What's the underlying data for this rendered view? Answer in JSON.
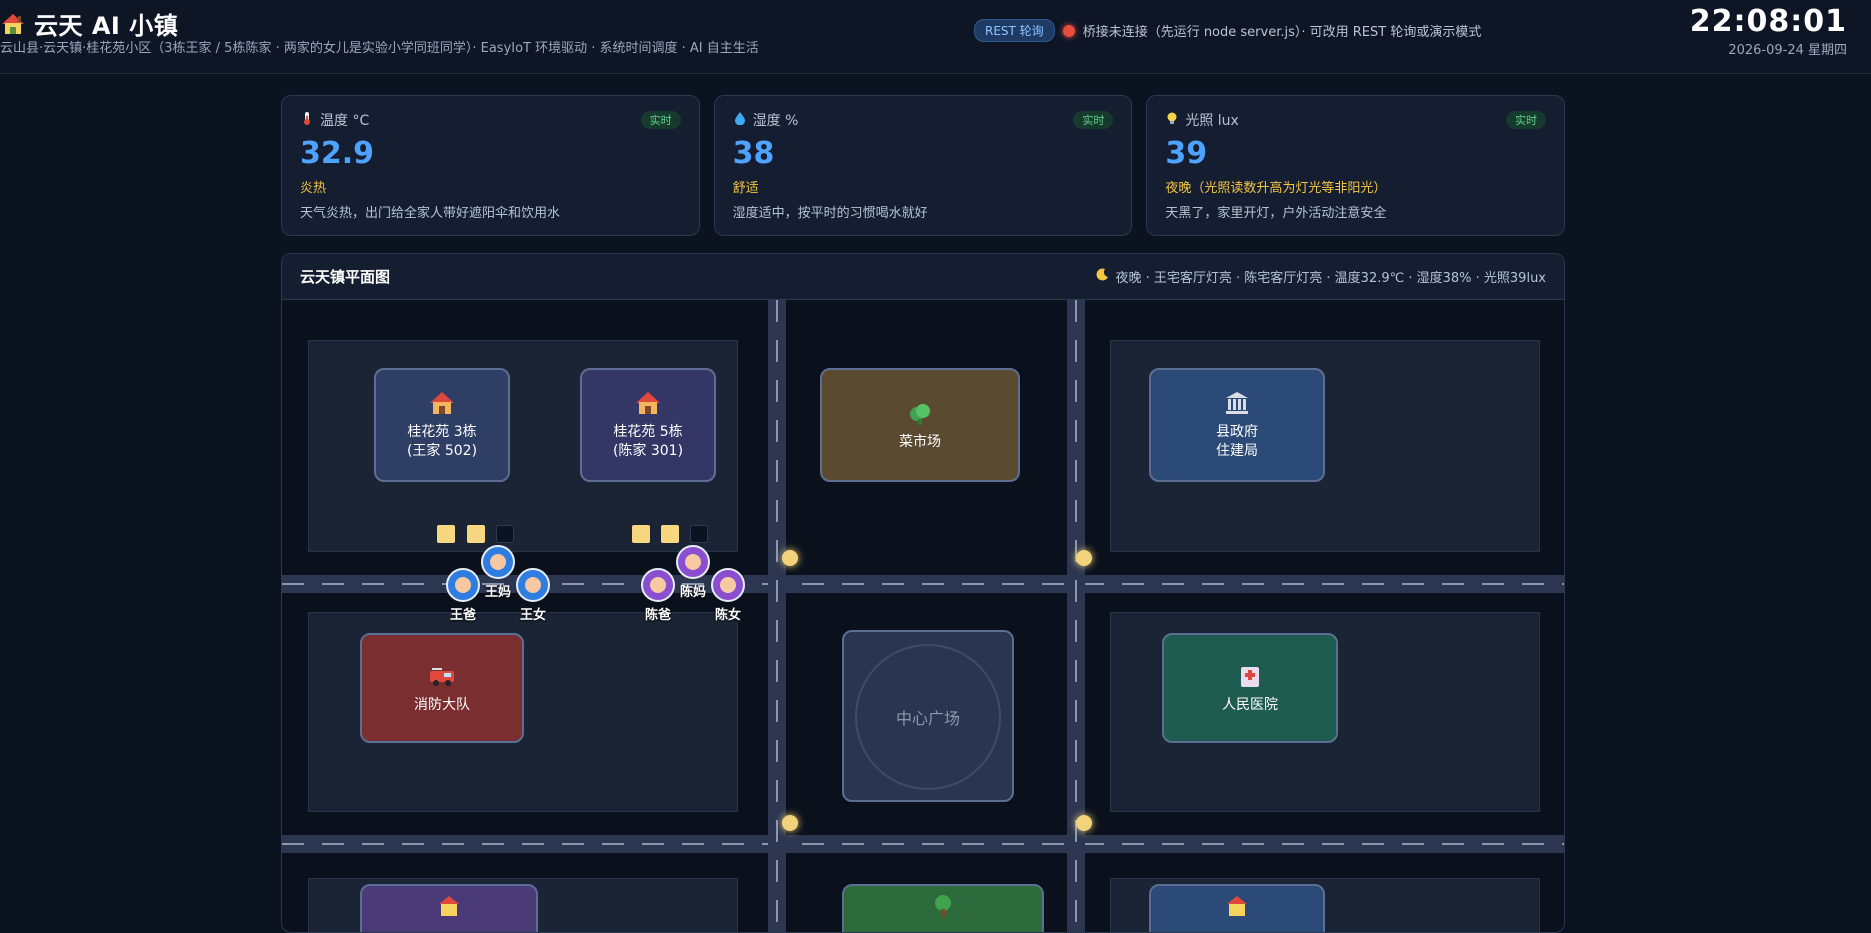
{
  "header": {
    "title": "云天 AI 小镇",
    "subtitle": "云山县·云天镇·桂花苑小区（3栋王家 / 5栋陈家 · 两家的女儿是实验小学同班同学）· EasyIoT 环境驱动 · 系统时间调度 · AI 自主生活",
    "mode_badge": "REST 轮询",
    "connection_status": "桥接未连接（先运行 node server.js）· 可改用 REST 轮询或演示模式",
    "status_color": "#e74c3c",
    "time": "22:08:01",
    "date": "2026-09-24 星期四"
  },
  "sensors": [
    {
      "icon": "thermometer-icon",
      "label": "温度 °C",
      "tag": "实时",
      "value": "32.9",
      "status": "炎热",
      "desc": "天气炎热，出门给全家人带好遮阳伞和饮用水"
    },
    {
      "icon": "droplet-icon",
      "label": "湿度 %",
      "tag": "实时",
      "value": "38",
      "status": "舒适",
      "desc": "湿度适中，按平时的习惯喝水就好"
    },
    {
      "icon": "bulb-icon",
      "label": "光照 lux",
      "tag": "实时",
      "value": "39",
      "status": "夜晚（光照读数升高为灯光等非阳光）",
      "desc": "天黑了，家里开灯，户外活动注意安全"
    }
  ],
  "map": {
    "title": "云天镇平面图",
    "info": "夜晚 · 王宅客厅灯亮 · 陈宅客厅灯亮 · 温度32.9℃ · 湿度38% · 光照39lux",
    "buildings": {
      "wang_home": {
        "line1": "桂花苑 3栋",
        "line2": "(王家 502)"
      },
      "chen_home": {
        "line1": "桂花苑 5栋",
        "line2": "(陈家 301)"
      },
      "market": {
        "line1": "菜市场"
      },
      "government": {
        "line1": "县政府",
        "line2": "住建局"
      },
      "fire": {
        "line1": "消防大队"
      },
      "plaza": {
        "line1": "中心广场"
      },
      "hospital": {
        "line1": "人民医院"
      }
    },
    "people": {
      "wang_dad": "王爸",
      "wang_mom": "王妈",
      "wang_girl": "王女",
      "chen_dad": "陈爸",
      "chen_mom": "陈妈",
      "chen_girl": "陈女"
    }
  }
}
